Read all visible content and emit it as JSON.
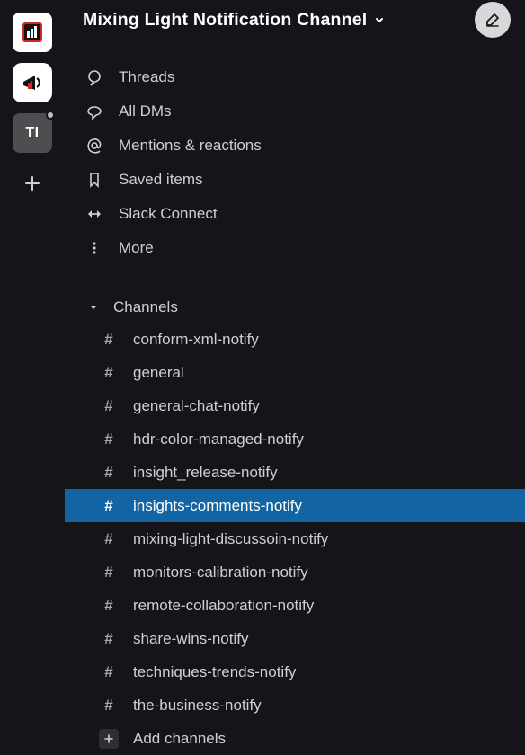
{
  "workspace_title": "Mixing Light Notification Channel",
  "ws3_label": "TI",
  "nav": {
    "threads": "Threads",
    "dms": "All DMs",
    "mentions": "Mentions & reactions",
    "saved": "Saved items",
    "connect": "Slack Connect",
    "more": "More"
  },
  "channels_section_label": "Channels",
  "channels": [
    {
      "name": "conform-xml-notify",
      "active": false
    },
    {
      "name": "general",
      "active": false
    },
    {
      "name": "general-chat-notify",
      "active": false
    },
    {
      "name": "hdr-color-managed-notify",
      "active": false
    },
    {
      "name": "insight_release-notify",
      "active": false
    },
    {
      "name": "insights-comments-notify",
      "active": true
    },
    {
      "name": "mixing-light-discussoin-notify",
      "active": false
    },
    {
      "name": "monitors-calibration-notify",
      "active": false
    },
    {
      "name": "remote-collaboration-notify",
      "active": false
    },
    {
      "name": "share-wins-notify",
      "active": false
    },
    {
      "name": "techniques-trends-notify",
      "active": false
    },
    {
      "name": "the-business-notify",
      "active": false
    }
  ],
  "add_channels_label": "Add channels"
}
